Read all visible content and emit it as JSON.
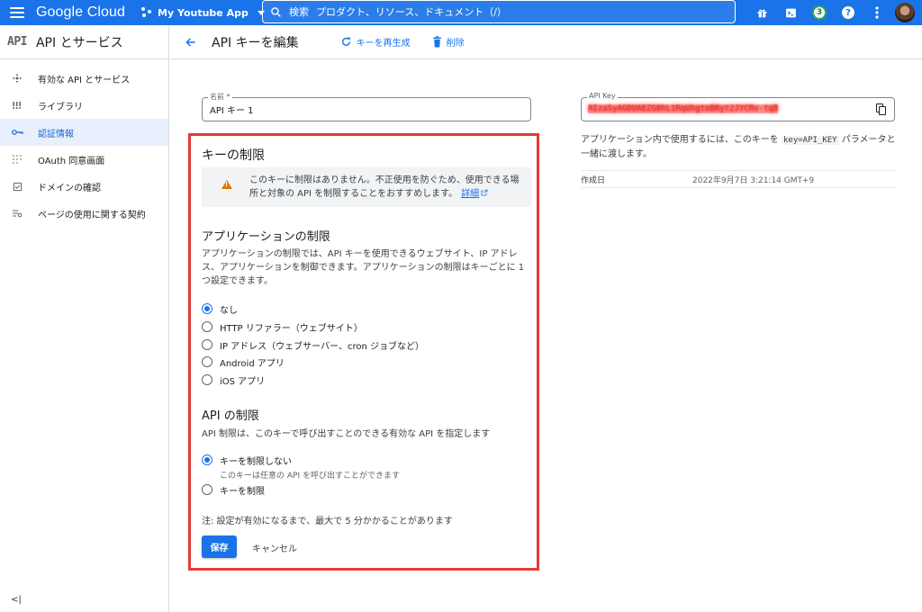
{
  "topbar": {
    "logo": "Google Cloud",
    "project": "My Youtube App",
    "search_icon": "search-icon",
    "search_label": "検索",
    "search_placeholder": "プロダクト、リソース、ドキュメント（/）",
    "notifications_count": "3",
    "help": "?"
  },
  "sidebar": {
    "logo": "API",
    "title": "API とサービス",
    "items": [
      {
        "label": "有効な API とサービス",
        "icon": "enabled-apis-icon",
        "active": false
      },
      {
        "label": "ライブラリ",
        "icon": "library-icon",
        "active": false
      },
      {
        "label": "認証情報",
        "icon": "key-icon",
        "active": true
      },
      {
        "label": "OAuth 同意画面",
        "icon": "oauth-icon",
        "active": false
      },
      {
        "label": "ドメインの確認",
        "icon": "domain-icon",
        "active": false
      },
      {
        "label": "ページの使用に関する契約",
        "icon": "agreement-icon",
        "active": false
      }
    ],
    "collapse": "<|"
  },
  "subheader": {
    "title": "API キーを編集",
    "regenerate": "キーを再生成",
    "delete": "削除"
  },
  "form": {
    "name_label": "名前 *",
    "name_value": "API キー 1",
    "key_restriction_heading": "キーの制限",
    "warning_text": "このキーに制限はありません。不正使用を防ぐため、使用できる場所と対象の API を制限することをおすすめします。",
    "warning_link": "詳細",
    "app_restriction_heading": "アプリケーションの制限",
    "app_restriction_desc": "アプリケーションの制限では、API キーを使用できるウェブサイト、IP アドレス、アプリケーションを制御できます。アプリケーションの制限はキーごとに 1 つ設定できます。",
    "app_options": [
      {
        "label": "なし",
        "selected": true
      },
      {
        "label": "HTTP リファラー（ウェブサイト）",
        "selected": false
      },
      {
        "label": "IP アドレス（ウェブサーバー、cron ジョブなど）",
        "selected": false
      },
      {
        "label": "Android アプリ",
        "selected": false
      },
      {
        "label": "iOS アプリ",
        "selected": false
      }
    ],
    "api_restriction_heading": "API の制限",
    "api_restriction_desc": "API 制限は、このキーで呼び出すことのできる有効な API を指定します",
    "api_options": [
      {
        "label": "キーを制限しない",
        "sub": "このキーは任意の API を呼び出すことができます",
        "selected": true
      },
      {
        "label": "キーを制限",
        "sub": "",
        "selected": false
      }
    ],
    "note": "注: 設定が有効になるまで、最大で 5 分かかることがあります",
    "save": "保存",
    "cancel": "キャンセル"
  },
  "key_panel": {
    "label": "API Key",
    "value": "AIzaSyAGDUAEZG0hL1RqUhgtoBRyt2JYCRv-tqB",
    "help_before": "アプリケーション内で使用するには、このキーを ",
    "help_code": "key=API_KEY",
    "help_after": " パラメータと一緒に渡します。",
    "created_label": "作成日",
    "created_value": "2022年9月7日 3:21:14 GMT+9"
  },
  "colors": {
    "brand": "#1a73e8",
    "highlight_border": "#e53935",
    "warning": "#e37400"
  }
}
